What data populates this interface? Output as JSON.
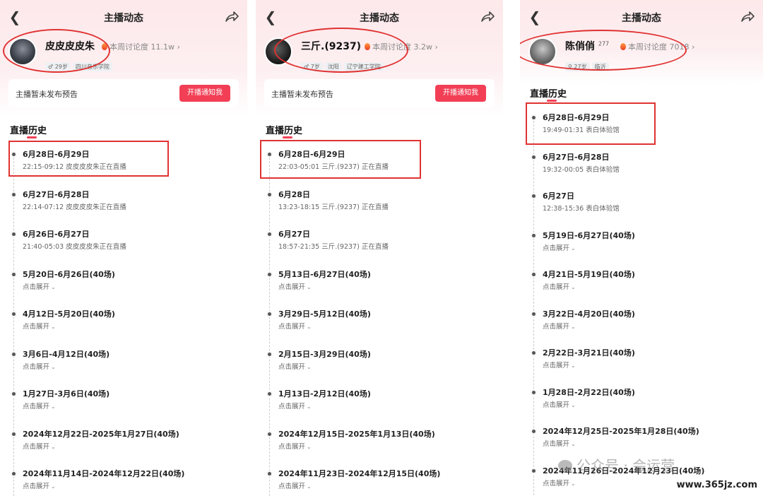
{
  "panels": [
    {
      "title": "主播动态",
      "streamer": {
        "name": "皮皮皮皮朱",
        "level": "",
        "heat": "本周讨论度 11.1w",
        "tags": [
          "♂ 29岁",
          "四川音乐学院"
        ]
      },
      "notice": {
        "text": "主播暂未发布预告",
        "button": "开播通知我"
      },
      "history_title": "直播历史",
      "items": [
        {
          "title": "6月28日-6月29日",
          "subtitle": "22:15-09:12 皮皮皮皮朱正在直播"
        },
        {
          "title": "6月27日-6月28日",
          "subtitle": "22:14-07:12 皮皮皮皮朱正在直播"
        },
        {
          "title": "6月26日-6月27日",
          "subtitle": "21:40-05:03 皮皮皮皮朱正在直播"
        },
        {
          "title": "5月20日-6月26日(40场)",
          "subtitle": "点击展开"
        },
        {
          "title": "4月12日-5月20日(40场)",
          "subtitle": "点击展开"
        },
        {
          "title": "3月6日-4月12日(40场)",
          "subtitle": "点击展开"
        },
        {
          "title": "1月27日-3月6日(40场)",
          "subtitle": "点击展开"
        },
        {
          "title": "2024年12月22日-2025年1月27日(40场)",
          "subtitle": "点击展开"
        },
        {
          "title": "2024年11月14日-2024年12月22日(40场)",
          "subtitle": "点击展开"
        }
      ]
    },
    {
      "title": "主播动态",
      "streamer": {
        "name": "三斤.(9237)",
        "level": "",
        "heat": "本周讨论度 3.2w",
        "tags": [
          "♂ 7岁",
          "沈阳",
          "辽宁建工学院"
        ]
      },
      "notice": {
        "text": "主播暂未发布预告",
        "button": "开播通知我"
      },
      "history_title": "直播历史",
      "items": [
        {
          "title": "6月28日-6月29日",
          "subtitle": "22:03-05:01 三斤.(9237) 正在直播"
        },
        {
          "title": "6月28日",
          "subtitle": "13:23-18:15 三斤.(9237) 正在直播"
        },
        {
          "title": "6月27日",
          "subtitle": "18:57-21:35 三斤.(9237) 正在直播"
        },
        {
          "title": "5月13日-6月27日(40场)",
          "subtitle": "点击展开"
        },
        {
          "title": "3月29日-5月12日(40场)",
          "subtitle": "点击展开"
        },
        {
          "title": "2月15日-3月29日(40场)",
          "subtitle": "点击展开"
        },
        {
          "title": "1月13日-2月12日(40场)",
          "subtitle": "点击展开"
        },
        {
          "title": "2024年12月15日-2025年1月13日(40场)",
          "subtitle": "点击展开"
        },
        {
          "title": "2024年11月23日-2024年12月15日(40场)",
          "subtitle": "点击展开"
        }
      ]
    },
    {
      "title": "主播动态",
      "streamer": {
        "name": "陈俏俏",
        "level": "277",
        "heat": "本周讨论度 7018",
        "tags": [
          "♀ 27岁",
          "临沂"
        ]
      },
      "history_title": "直播历史",
      "items": [
        {
          "title": "6月28日-6月29日",
          "subtitle": "19:49-01:31 表白体验馆"
        },
        {
          "title": "6月27日-6月28日",
          "subtitle": "19:32-00:05 表白体验馆"
        },
        {
          "title": "6月27日",
          "subtitle": "12:38-15:36 表白体验馆"
        },
        {
          "title": "5月19日-6月27日(40场)",
          "subtitle": "点击展开"
        },
        {
          "title": "4月21日-5月19日(40场)",
          "subtitle": "点击展开"
        },
        {
          "title": "3月22日-4月20日(40场)",
          "subtitle": "点击展开"
        },
        {
          "title": "2月22日-3月21日(40场)",
          "subtitle": "点击展开"
        },
        {
          "title": "1月28日-2月22日(40场)",
          "subtitle": "点击展开"
        },
        {
          "title": "2024年12月25日-2025年1月28日(40场)",
          "subtitle": "点击展开"
        },
        {
          "title": "2024年11月26日-2024年12月23日(40场)",
          "subtitle": "点击展开"
        }
      ]
    }
  ],
  "watermarks": {
    "account": "公众号 · 会运营",
    "site": "www.365jz.com"
  },
  "colors": {
    "accent": "#f23f56",
    "highlight": "#e03232"
  }
}
